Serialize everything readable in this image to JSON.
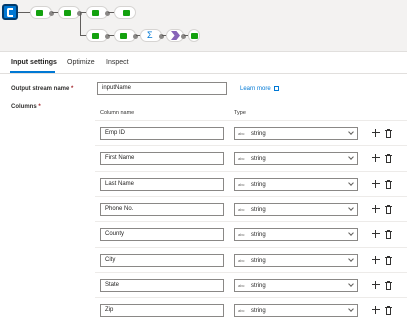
{
  "tabs": [
    {
      "label": "Input settings"
    },
    {
      "label": "Optimize"
    },
    {
      "label": "Inspect"
    }
  ],
  "form": {
    "output_stream_label": "Output stream name",
    "required_marker": "*",
    "output_stream_value": "inputName",
    "learn_more": "Learn more",
    "columns_label": "Columns",
    "col_name_header": "Column name",
    "type_header": "Type"
  },
  "columns": [
    {
      "name": "Emp ID",
      "type": "string",
      "type_badge": "abc"
    },
    {
      "name": "First Name",
      "type": "string",
      "type_badge": "abc"
    },
    {
      "name": "Last Name",
      "type": "string",
      "type_badge": "abc"
    },
    {
      "name": "Phone No.",
      "type": "string",
      "type_badge": "abc"
    },
    {
      "name": "County",
      "type": "string",
      "type_badge": "abc"
    },
    {
      "name": "City",
      "type": "string",
      "type_badge": "abc"
    },
    {
      "name": "State",
      "type": "string",
      "type_badge": "abc"
    },
    {
      "name": "Zip",
      "type": "string",
      "type_badge": "abc"
    }
  ],
  "colors": {
    "accent": "#0078d4",
    "node_green": "#13a10e",
    "node_purple": "#8764b8"
  }
}
